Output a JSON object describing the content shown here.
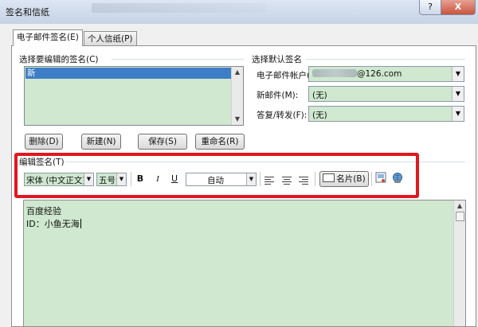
{
  "window": {
    "title": "签名和信纸",
    "help_label": "?",
    "close_label": "X"
  },
  "tabs": [
    {
      "label": "电子邮件签名(E)"
    },
    {
      "label": "个人信纸(P)"
    }
  ],
  "select_signature": {
    "label": "选择要编辑的签名(C)",
    "items": [
      "新"
    ]
  },
  "buttons": {
    "delete": "删除(D)",
    "new": "新建(N)",
    "save": "保存(S)",
    "rename": "重命名(R)"
  },
  "default_signature": {
    "label": "选择默认签名",
    "account_label": "电子邮件帐户(A):",
    "account_value": "@126.com",
    "new_messages_label": "新邮件(M):",
    "new_messages_value": "(无)",
    "replies_label": "答复/转发(F):",
    "replies_value": "(无)"
  },
  "edit_signature": {
    "label": "编辑签名(T)",
    "font_value": "宋体 (中文正文)",
    "size_value": "五号",
    "bold": "B",
    "italic": "I",
    "underline": "U",
    "color_value": "自动",
    "business_card": "名片(B)",
    "content_lines": [
      "百度经验",
      "ID：小鱼无海"
    ]
  },
  "colors": {
    "field_bg": "#cfe8cf",
    "selection": "#3e7ec6",
    "highlight": "#e0181f"
  }
}
